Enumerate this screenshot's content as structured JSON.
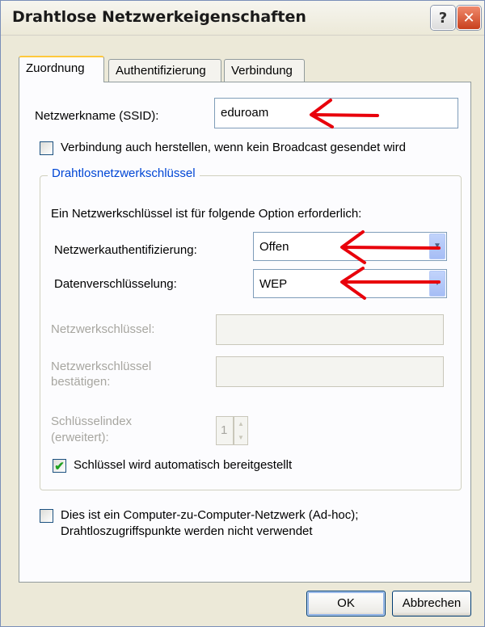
{
  "window": {
    "title": "Drahtlose Netzwerkeigenschaften",
    "help_glyph": "?",
    "close_glyph": "✕"
  },
  "tabs": [
    {
      "label": "Zuordnung",
      "active": true
    },
    {
      "label": "Authentifizierung",
      "active": false
    },
    {
      "label": "Verbindung",
      "active": false
    }
  ],
  "ssid": {
    "label": "Netzwerkname (SSID):",
    "value": "eduroam"
  },
  "no_broadcast": {
    "label": "Verbindung auch herstellen, wenn kein Broadcast gesendet wird",
    "checked": false
  },
  "key_group": {
    "title": "Drahtlosnetzwerkschlüssel",
    "intro": "Ein Netzwerkschlüssel ist für folgende Option erforderlich:",
    "auth": {
      "label": "Netzwerkauthentifizierung:",
      "value": "Offen"
    },
    "encryption": {
      "label": "Datenverschlüsselung:",
      "value": "WEP"
    },
    "key": {
      "label": "Netzwerkschlüssel:",
      "value": ""
    },
    "key_confirm": {
      "label_line1": "Netzwerkschlüssel",
      "label_line2": "bestätigen:",
      "value": ""
    },
    "key_index": {
      "label_line1": "Schlüsselindex",
      "label_line2": "(erweitert):",
      "value": "1"
    },
    "auto_key": {
      "label": "Schlüssel wird automatisch bereitgestellt",
      "checked": true
    }
  },
  "adhoc": {
    "label_line1": "Dies ist ein Computer-zu-Computer-Netzwerk (Ad-hoc);",
    "label_line2": "Drahtloszugriffspunkte werden nicht verwendet",
    "checked": false
  },
  "buttons": {
    "ok": "OK",
    "cancel": "Abbrechen"
  },
  "colors": {
    "accent_arrow": "#e8000b",
    "group_title": "#0046d5",
    "tab_highlight": "#ffc83c"
  },
  "icons": {
    "checkmark": "✔",
    "dropdown": "▼",
    "spin_up": "▲",
    "spin_down": "▼"
  }
}
